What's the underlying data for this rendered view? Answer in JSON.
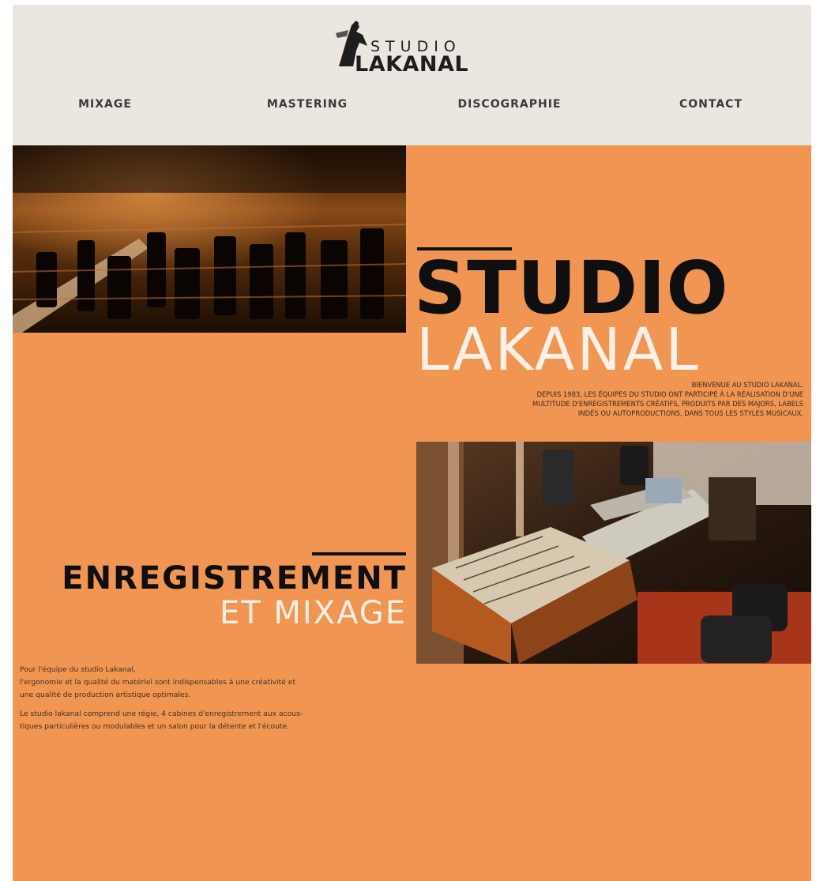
{
  "logo": {
    "studio": "STUDIO",
    "lakanal": "LAKANAL",
    "icon": "eagle-logo-mark-icon"
  },
  "nav": {
    "items": [
      {
        "label": "MIXAGE"
      },
      {
        "label": "MASTERING"
      },
      {
        "label": "DISCOGRAPHIE"
      },
      {
        "label": "CONTACT"
      }
    ]
  },
  "hero": {
    "title_bold": "STUDIO",
    "title_light": "LAKANAL",
    "intro_lines": [
      "BIENVENUE AU STUDIO LAKANAL.",
      "DEPUIS 1983, LES ÉQUIPES DU STUDIO ONT PARTICIPÉ À LA RÉALISATION D'UNE",
      "MULTITUDE D'ENREGISTREMENTS CRÉATIFS, PRODUITS PAR DES MAJORS, LABELS",
      "INDÉS OU AUTOPRODUCTIONS, DANS TOUS LES STYLES MUSICAUX."
    ]
  },
  "section": {
    "title_bold": "ENREGISTREMENT",
    "title_light": "ET MIXAGE",
    "paragraph1_lines": [
      "Pour l'équipe du studio Lakanal,",
      "l'ergonomie et la qualité du matériel sont indispensables à une créativité et",
      "une qualité de production artistique optimales."
    ],
    "paragraph2_lines": [
      "Le studio lakanal comprend une régie, 4 cabines d'enregistrement aux acous-",
      "tiques particulières ou modulables et un salon pour la détente et l'écoute."
    ]
  },
  "colors": {
    "header_bg": "#ebe7e0",
    "main_bg": "#f09552",
    "accent_dark": "#0f0f0f",
    "accent_light": "#fbf1e6"
  }
}
